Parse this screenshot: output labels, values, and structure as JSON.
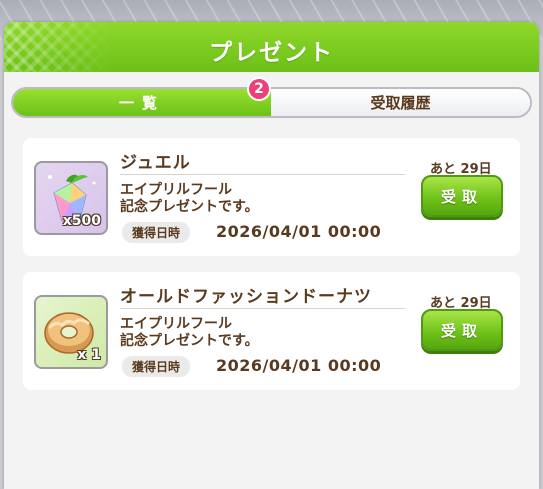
{
  "dialog": {
    "title": "プレゼント"
  },
  "tabs": {
    "list_label": "一覧",
    "history_label": "受取履歴",
    "badge_count": "2"
  },
  "presents": [
    {
      "name": "ジュエル",
      "icon": "jewel-icon",
      "quantity": "x500",
      "description_line1": "エイプリルフール",
      "description_line2": "記念プレゼントです。",
      "acquired_label": "獲得日時",
      "acquired_date": "2026/04/01 00:00",
      "remaining": "あと 29日",
      "receive_label": "受取"
    },
    {
      "name": "オールドファッションドーナツ",
      "icon": "donut-icon",
      "quantity": "x 1",
      "description_line1": "エイプリルフール",
      "description_line2": "記念プレゼントです。",
      "acquired_label": "獲得日時",
      "acquired_date": "2026/04/01 00:00",
      "remaining": "あと 29日",
      "receive_label": "受取"
    }
  ],
  "colors": {
    "header_green": "#7ccb1f",
    "button_green": "#6cc016",
    "badge_pink": "#ee3f78",
    "text_brown": "#5a3a1e"
  }
}
